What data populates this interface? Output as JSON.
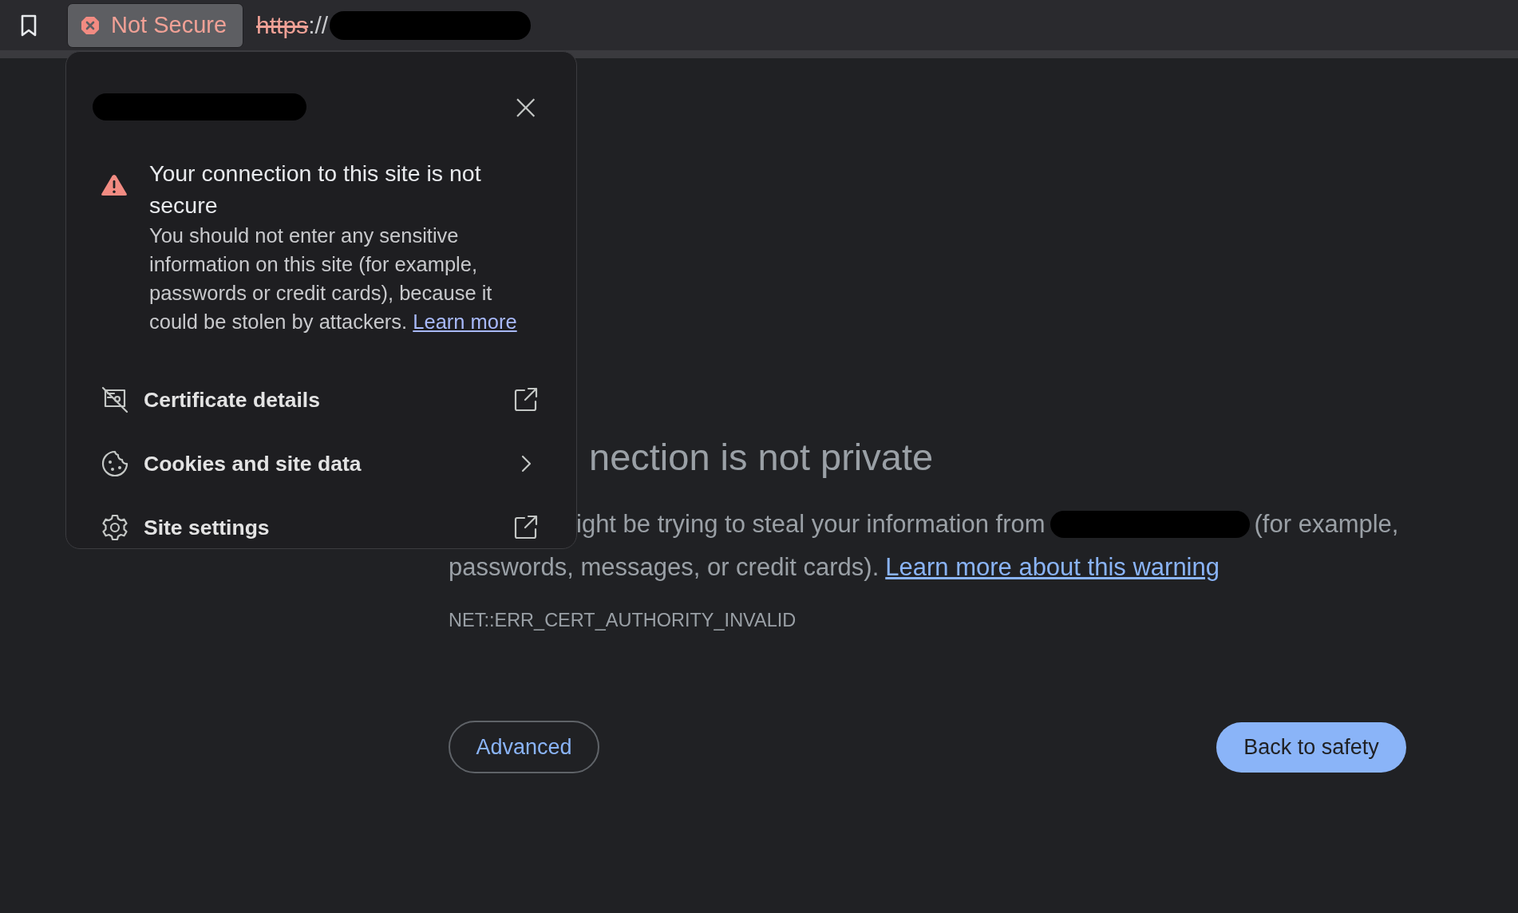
{
  "toolbar": {
    "security_chip": {
      "label": "Not Secure"
    },
    "url": {
      "scheme": "https",
      "scheme_struck": true,
      "separator": "://",
      "host_redacted": true
    }
  },
  "site_popup": {
    "title_redacted": true,
    "close": "×",
    "warning": {
      "title": "Your connection to this site is not secure",
      "body": "You should not enter any sensitive information on this site (for example, passwords or credit cards), because it could be stolen by attackers.",
      "link": "Learn more"
    },
    "items": [
      {
        "label": "Certificate details",
        "kind": "external"
      },
      {
        "label": "Cookies and site data",
        "kind": "submenu"
      },
      {
        "label": "Site settings",
        "kind": "external"
      }
    ]
  },
  "page": {
    "heading": "nection is not private",
    "line_1": {
      "before": "ight be trying to steal your information from",
      "site_redacted": true,
      "after": "(for example,"
    },
    "line_2": {
      "text": "passwords, messages, or credit cards).",
      "link": "Learn more about this warning"
    },
    "error_code": "NET::ERR_CERT_AUTHORITY_INVALID",
    "buttons": [
      {
        "label": "Advanced",
        "kind": "secondary"
      },
      {
        "label": "Back to safety",
        "kind": "primary"
      }
    ]
  }
}
